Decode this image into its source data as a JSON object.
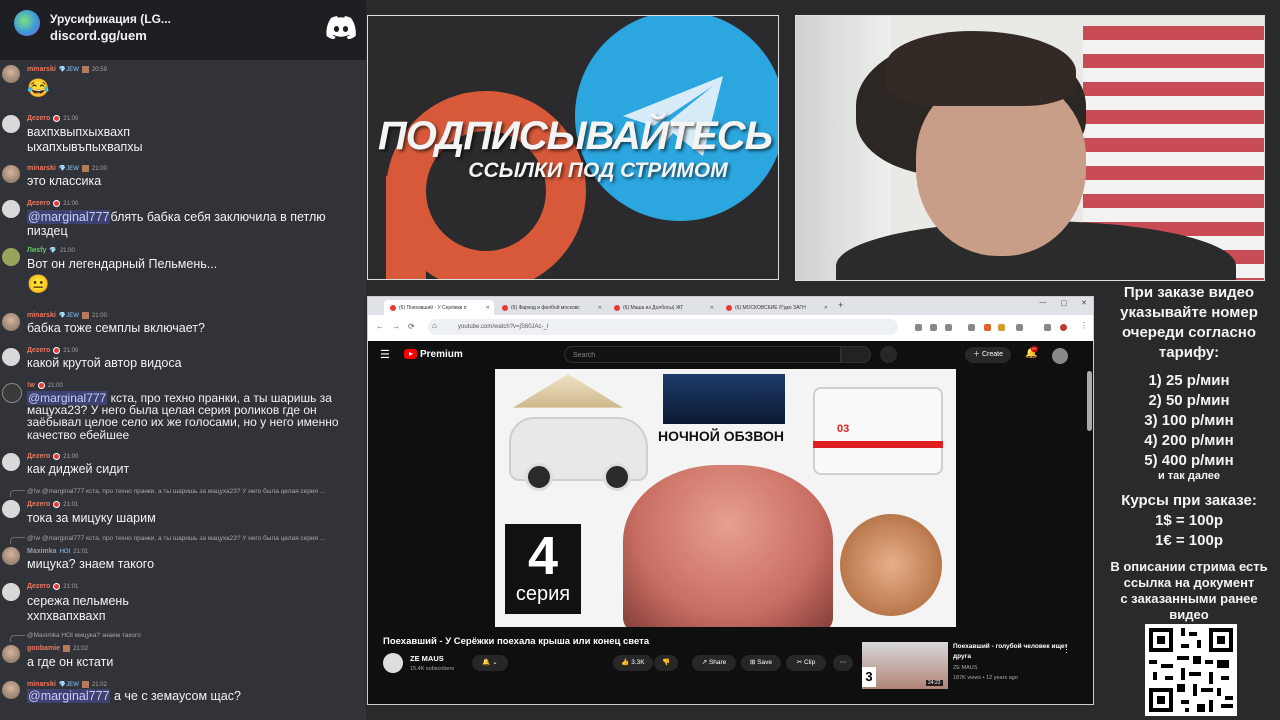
{
  "chat": {
    "server_name": "Урусификация (LG...",
    "invite": "discord.gg/uem",
    "messages": [
      {
        "user": "minarski",
        "badge": "💎JEW",
        "time": "20:59",
        "text": "",
        "emoji": "😂"
      },
      {
        "user": "Дezero",
        "time": "21:00",
        "text": "вахпхвыпхыхвахп ыхапхывъпыхвапхы"
      },
      {
        "user": "minarski",
        "badge": "💎JEW",
        "time": "21:00",
        "text": "это классика"
      },
      {
        "user": "Дezero",
        "time": "21:00",
        "mention": "@marginal777",
        "text": "блять бабка себя заключила в петлю пиздец"
      },
      {
        "user": "Лиsfy",
        "time": "21:00",
        "text": "Вот он легендарный Пельмень...",
        "sticker": "😐"
      },
      {
        "user": "minarski",
        "badge": "💎JEW",
        "time": "21:00",
        "text": "бабка тоже семплы включает?"
      },
      {
        "user": "Дezero",
        "time": "21:00",
        "text": "какой крутой автор видоса"
      },
      {
        "user": "!w",
        "time": "21:00",
        "mention": "@marginal777",
        "text": " кста, про техно пранки, а ты шаришь за мацуха23? У него была целая серия роликов где он заёбывал целое село их же голосами, но у него именно качество ебейшее"
      },
      {
        "user": "Дezero",
        "time": "21:00",
        "text": "как диджей сидит"
      },
      {
        "reply": "@!w @marginal777 кста, про техно пранки, а ты шаришь за мацуха23? У него была целая серия ...",
        "user": "Дezero",
        "time": "21:01",
        "text": "тока за мицуку шарим"
      },
      {
        "reply": "@!w @marginal777 кста, про техно пранки, а ты шаришь за мацуха23? У него была целая серия ...",
        "user": "Maximka",
        "badge": "HOI",
        "time": "21:01",
        "text": "мицука? знаем такого"
      },
      {
        "user": "Дezero",
        "time": "21:01",
        "text": "сережа пельмень ххпхвапхвахп"
      },
      {
        "reply": "@Maximka HOI мицука? знаем такого",
        "user": "goobamie",
        "time": "21:02",
        "text": "а где он кстати"
      },
      {
        "user": "minarski",
        "badge": "💎JEW",
        "time": "21:02",
        "mention": "@marginal777",
        "text": " а че с земаусом щас?"
      }
    ]
  },
  "promo": {
    "title": "ПОДПИСЫВАЙТЕСЬ",
    "subtitle": "ССЫЛКИ ПОД СТРИМОМ"
  },
  "browser": {
    "tabs": [
      "(6) Поехавший - У Серёжки п",
      "(6) Фарход и фелбой московс",
      "(6) Маша из Долбосы) ЖГ",
      "(6) МОСКОВСКИЕ б*дко ЗАГН"
    ],
    "url": "youtube.com/watch?v=jS60JAc-_I",
    "search_placeholder": "Search",
    "brand": "Premium",
    "create_label": "Create",
    "notif_count": "9+",
    "thumbnail": {
      "caption": "НОЧНОЙ ОБЗВОН",
      "episode_number": "4",
      "episode_label": "серия",
      "ambulance_number": "03"
    },
    "video_title": "Поехавший - У Серёжки поехала крыша или конец света",
    "channel_name": "ZE MAUS",
    "subscribers": "15.4K subscribers",
    "likes": "3.3K",
    "share_label": "Share",
    "save_label": "Save",
    "clip_label": "Clip",
    "rec": {
      "title": "Поехавший - голубой человек ищет друга",
      "channel": "ZE MAUS",
      "stats": "187K views • 12 years ago",
      "duration": "24:22",
      "number": "3"
    }
  },
  "info": {
    "order_intro": [
      "При заказе видео",
      "указывайте номер",
      "очереди согласно",
      "тарифу:"
    ],
    "tariffs": [
      "1) 25 р/мин",
      "2) 50 р/мин",
      "3) 100 р/мин",
      "4) 200 р/мин",
      "5) 400 р/мин"
    ],
    "etc": "и так далее",
    "rates_title": "Курсы при заказе:",
    "rates": [
      "1$ = 100р",
      "1€ = 100р"
    ],
    "desc": [
      "В описании стрима есть",
      "ссылка на документ",
      "с заказанными ранее",
      "видео"
    ]
  },
  "colors": {
    "chat_bg": "#313338",
    "username_red": "#f0765f",
    "mention_bg": "#3d4270",
    "youtube_red": "#ff0000",
    "telegram_blue": "#2ca6df",
    "promo_orange": "#d7593a"
  }
}
